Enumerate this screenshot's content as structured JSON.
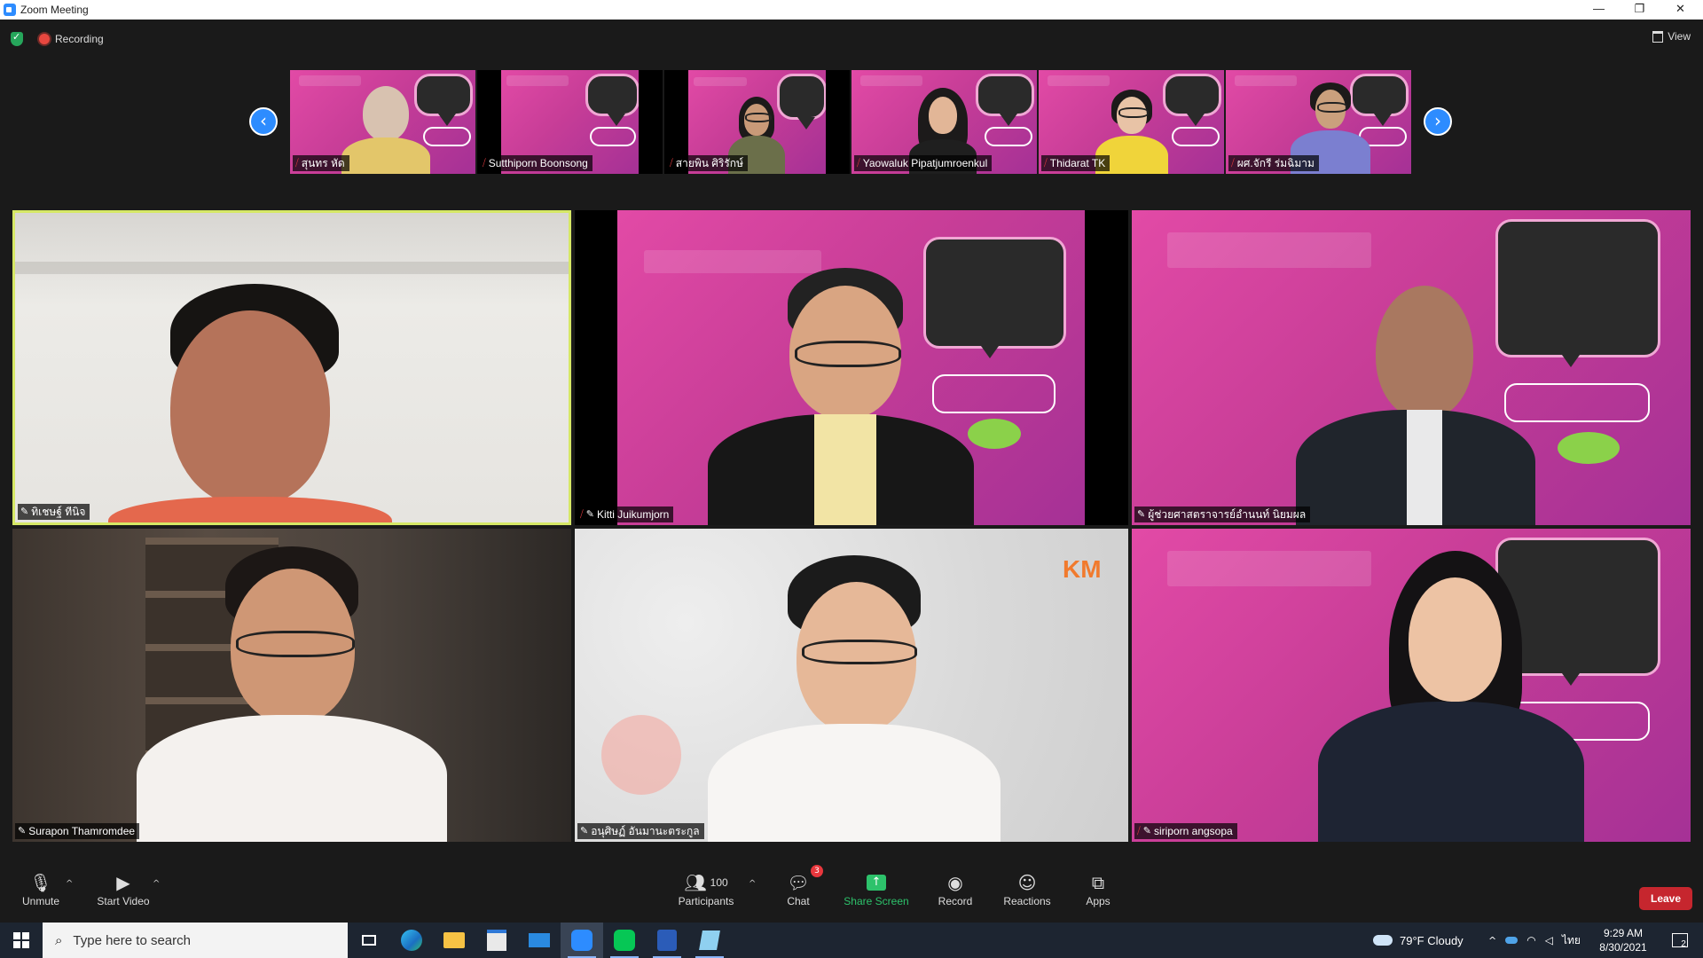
{
  "window": {
    "title": "Zoom Meeting",
    "minimize": "—",
    "restore": "❐",
    "close": "✕"
  },
  "status": {
    "recording_label": "Recording",
    "view_label": "View"
  },
  "thumbnails": [
    {
      "name": "สุนทร หัด"
    },
    {
      "name": "Sutthiporn Boonsong"
    },
    {
      "name": "สายพิน ศิริรักษ์"
    },
    {
      "name": "Yaowaluk Pipatjumroenkul"
    },
    {
      "name": "Thidarat TK"
    },
    {
      "name": "ผศ.จักรี ร่มฉิมาม"
    }
  ],
  "tiles": [
    {
      "name": "ทิเชษฐ์ ทีนิจ"
    },
    {
      "name": "Kitti Juikumjorn"
    },
    {
      "name": "ผู้ช่วยศาสตราจารย์อำนนท์ นิยมผล"
    },
    {
      "name": "Surapon Thamromdee"
    },
    {
      "name": "อนุศิษฏ์ อันมานะตระกูล"
    },
    {
      "name": "siriporn angsopa"
    }
  ],
  "toolbar": {
    "unmute": "Unmute",
    "start_video": "Start Video",
    "participants_count": "100",
    "participants": "Participants",
    "chat": "Chat",
    "chat_badge": "3",
    "share_screen": "Share Screen",
    "record": "Record",
    "reactions": "Reactions",
    "apps": "Apps",
    "leave": "Leave"
  },
  "taskbar": {
    "search_placeholder": "Type here to search",
    "weather": "79°F  Cloudy",
    "lang": "ไทย",
    "time": "9:29 AM",
    "date": "8/30/2021",
    "notif_count": "2"
  },
  "colors": {
    "accent": "#2d8cff",
    "share": "#2dc26b",
    "leave": "#c6262e",
    "active_speaker": "#d6e866",
    "slide_pink": "#d342a0"
  }
}
